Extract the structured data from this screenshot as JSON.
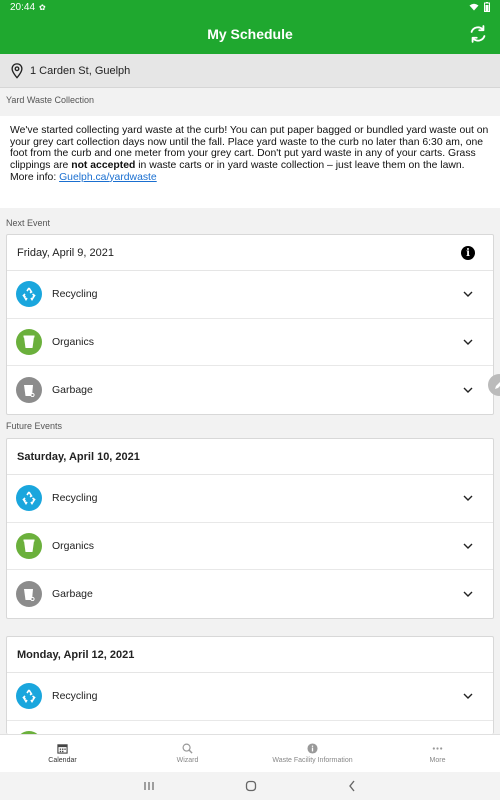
{
  "status": {
    "time": "20:44",
    "extra_icon": "✿"
  },
  "app": {
    "title": "My Schedule"
  },
  "address": "1 Carden St, Guelph",
  "notice": {
    "section_label": "Yard Waste Collection",
    "text_part1": "We've started collecting yard waste at the curb! You can put paper bagged or bundled yard waste out on your grey cart collection days now until the fall. Place yard waste to the curb no later than 6:30 am, one foot from the curb and one meter from your grey cart. Don't put yard waste in any of your carts. Grass clippings are ",
    "text_bold": "not accepted",
    "text_part2": " in waste carts or in yard waste collection – just leave them on the lawn.",
    "more_info_label": "More info: ",
    "link_text": "Guelph.ca/yardwaste"
  },
  "next_event": {
    "section_label": "Next Event",
    "date": "Friday, April 9, 2021",
    "items": [
      {
        "label": "Recycling",
        "icon": "recycling-icon"
      },
      {
        "label": "Organics",
        "icon": "organics-icon"
      },
      {
        "label": "Garbage",
        "icon": "garbage-icon"
      }
    ]
  },
  "future_events": {
    "section_label": "Future Events",
    "events": [
      {
        "date": "Saturday, April 10, 2021",
        "items": [
          {
            "label": "Recycling"
          },
          {
            "label": "Organics"
          },
          {
            "label": "Garbage"
          }
        ]
      },
      {
        "date": "Monday, April 12, 2021",
        "items": [
          {
            "label": "Recycling"
          }
        ]
      }
    ]
  },
  "colors": {
    "brand": "#1fa82f",
    "recycling": "#1aa6dd",
    "organics": "#6bb03c",
    "garbage": "#8c8c8c"
  },
  "bottom_nav": [
    {
      "label": "Calendar",
      "icon": "calendar-icon",
      "active": true
    },
    {
      "label": "Wizard",
      "icon": "search-icon",
      "active": false
    },
    {
      "label": "Waste Facility Information",
      "icon": "info-icon",
      "active": false
    },
    {
      "label": "More",
      "icon": "more-icon",
      "active": false
    }
  ]
}
